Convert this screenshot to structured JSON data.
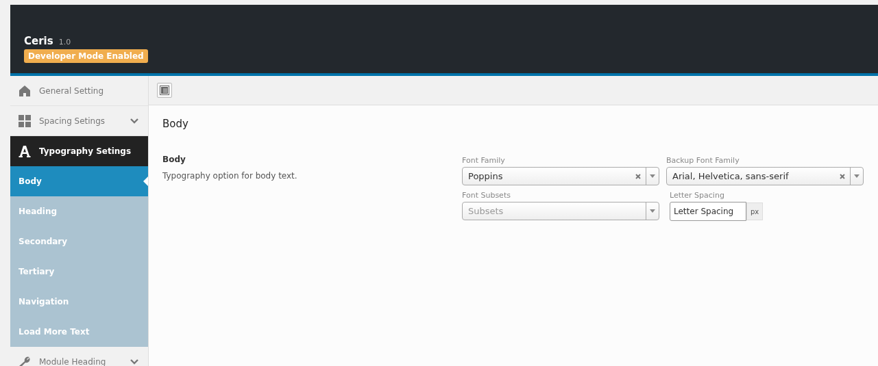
{
  "header": {
    "title": "Ceris",
    "version": "1.0",
    "badge": "Developer Mode Enabled"
  },
  "sidebar": {
    "items": [
      {
        "label": "General Setting",
        "has_caret": false,
        "selected": false
      },
      {
        "label": "Spacing Setings",
        "has_caret": true,
        "selected": false
      },
      {
        "label": "Typography Setings",
        "has_caret": false,
        "selected": true,
        "children": [
          {
            "label": "Body",
            "selected": true
          },
          {
            "label": "Heading",
            "selected": false
          },
          {
            "label": "Secondary",
            "selected": false
          },
          {
            "label": "Tertiary",
            "selected": false
          },
          {
            "label": "Navigation",
            "selected": false
          },
          {
            "label": "Load More Text",
            "selected": false
          }
        ]
      },
      {
        "label": "Module Heading",
        "has_caret": true,
        "selected": false
      }
    ]
  },
  "section": {
    "title": "Body",
    "option": {
      "title": "Body",
      "description": "Typography option for body text."
    },
    "fields": [
      {
        "kind": "select",
        "label": "Font Family",
        "value": "Poppins",
        "clearable": true
      },
      {
        "kind": "select",
        "label": "Backup Font Family",
        "value": "Arial, Helvetica, sans-serif",
        "clearable": true
      },
      {
        "kind": "select",
        "label": "Font Subsets",
        "placeholder": "Subsets",
        "clearable": false
      },
      {
        "kind": "unit",
        "label": "Letter Spacing",
        "placeholder": "Letter Spacing",
        "unit": "px"
      }
    ]
  }
}
